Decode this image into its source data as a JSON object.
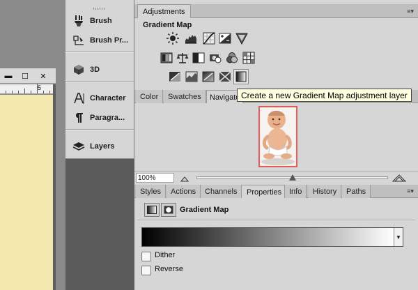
{
  "document": {
    "window_buttons": [
      "▬",
      "☐",
      "✕"
    ],
    "ruler_label": "5"
  },
  "dock": {
    "items": [
      {
        "label": "Brush",
        "icon": "brush-icon"
      },
      {
        "label": "Brush Pr...",
        "icon": "brush-presets-icon"
      },
      {
        "label": "3D",
        "icon": "3d-cube-icon"
      },
      {
        "label": "Character",
        "icon": "character-icon"
      },
      {
        "label": "Paragra...",
        "icon": "paragraph-icon"
      },
      {
        "label": "Layers",
        "icon": "layers-icon"
      }
    ]
  },
  "adjustments": {
    "tab": "Adjustments",
    "title": "Gradient Map",
    "icons": [
      "brightness-contrast-icon",
      "levels-icon",
      "curves-icon",
      "exposure-icon",
      "vibrance-icon",
      "hue-saturation-icon",
      "color-balance-icon",
      "black-white-icon",
      "photo-filter-icon",
      "channel-mixer-icon",
      "color-lookup-icon",
      "invert-icon",
      "posterize-icon",
      "threshold-icon",
      "gradient-map-icon"
    ],
    "tooltip": "Create a new Gradient Map adjustment layer"
  },
  "navigator": {
    "tabs": [
      "Color",
      "Swatches",
      "Navigato"
    ],
    "active_tab": "Navigato",
    "zoom": "100%",
    "zoom_fraction": 0.5
  },
  "properties": {
    "tabs": [
      "Styles",
      "Actions",
      "Channels",
      "Properties",
      "Info",
      "History",
      "Paths"
    ],
    "active_tab": "Properties",
    "title": "Gradient Map",
    "gradient": {
      "from": "#000000",
      "to": "#ffffff"
    },
    "dither_label": "Dither",
    "reverse_label": "Reverse",
    "dither": false,
    "reverse": false
  },
  "colors": {
    "panel": "#d6d6d6",
    "canvas": "#f3e9ae",
    "thumb_border": "#e25b5b",
    "tooltip_bg": "#ffffe1"
  }
}
